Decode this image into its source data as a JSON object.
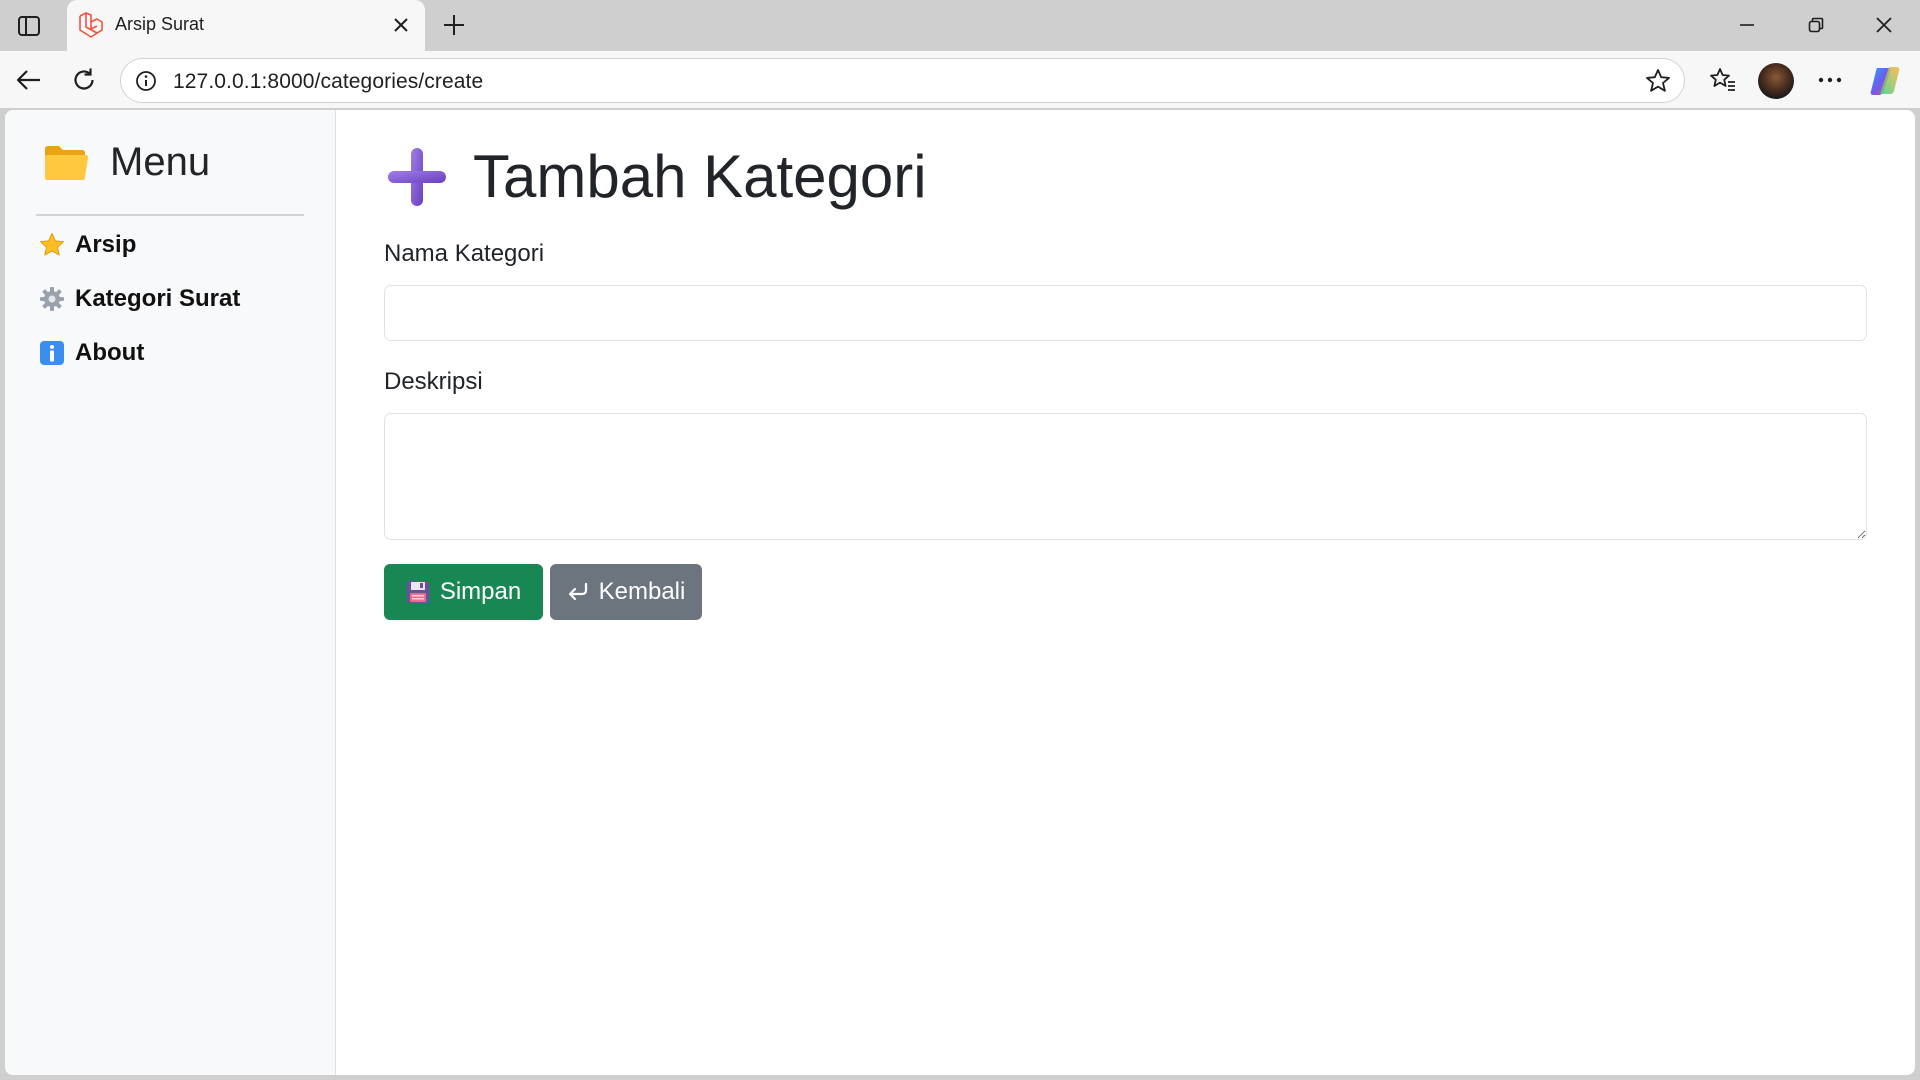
{
  "browser": {
    "tab_title": "Arsip Surat",
    "url": "127.0.0.1:8000/categories/create"
  },
  "sidebar": {
    "title": "Menu",
    "header_icon": "folder-icon",
    "items": [
      {
        "label": "Arsip",
        "icon": "star-icon"
      },
      {
        "label": "Kategori Surat",
        "icon": "gear-icon"
      },
      {
        "label": "About",
        "icon": "info-icon"
      }
    ]
  },
  "main": {
    "title": "Tambah Kategori",
    "title_icon": "plus-icon",
    "form": {
      "name_label": "Nama Kategori",
      "name_value": "",
      "description_label": "Deskripsi",
      "description_value": "",
      "save_label": "Simpan",
      "back_label": "Kembali"
    }
  },
  "colors": {
    "save_button": "#198754",
    "back_button": "#6c757d",
    "sidebar_bg": "#f8f9fa",
    "plus_icon": "#7b52c8"
  }
}
